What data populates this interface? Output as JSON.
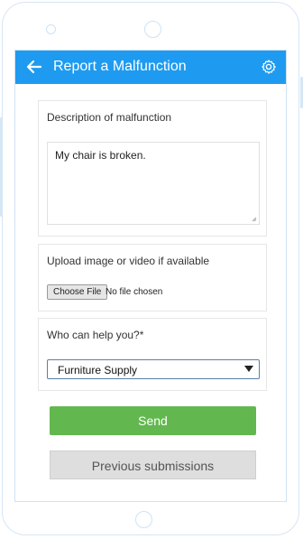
{
  "header": {
    "title": "Report a Malfunction"
  },
  "description": {
    "label": "Description of malfunction",
    "value": "My chair is broken."
  },
  "upload": {
    "label": "Upload image or video if available",
    "button_label": "Choose File",
    "status": "No file chosen"
  },
  "helper": {
    "label": "Who can help you?*",
    "selected": "Furniture Supply"
  },
  "actions": {
    "send_label": "Send",
    "previous_label": "Previous submissions"
  },
  "colors": {
    "appbar": "#1e9bf0",
    "send": "#62b84f",
    "secondary": "#dedede"
  }
}
